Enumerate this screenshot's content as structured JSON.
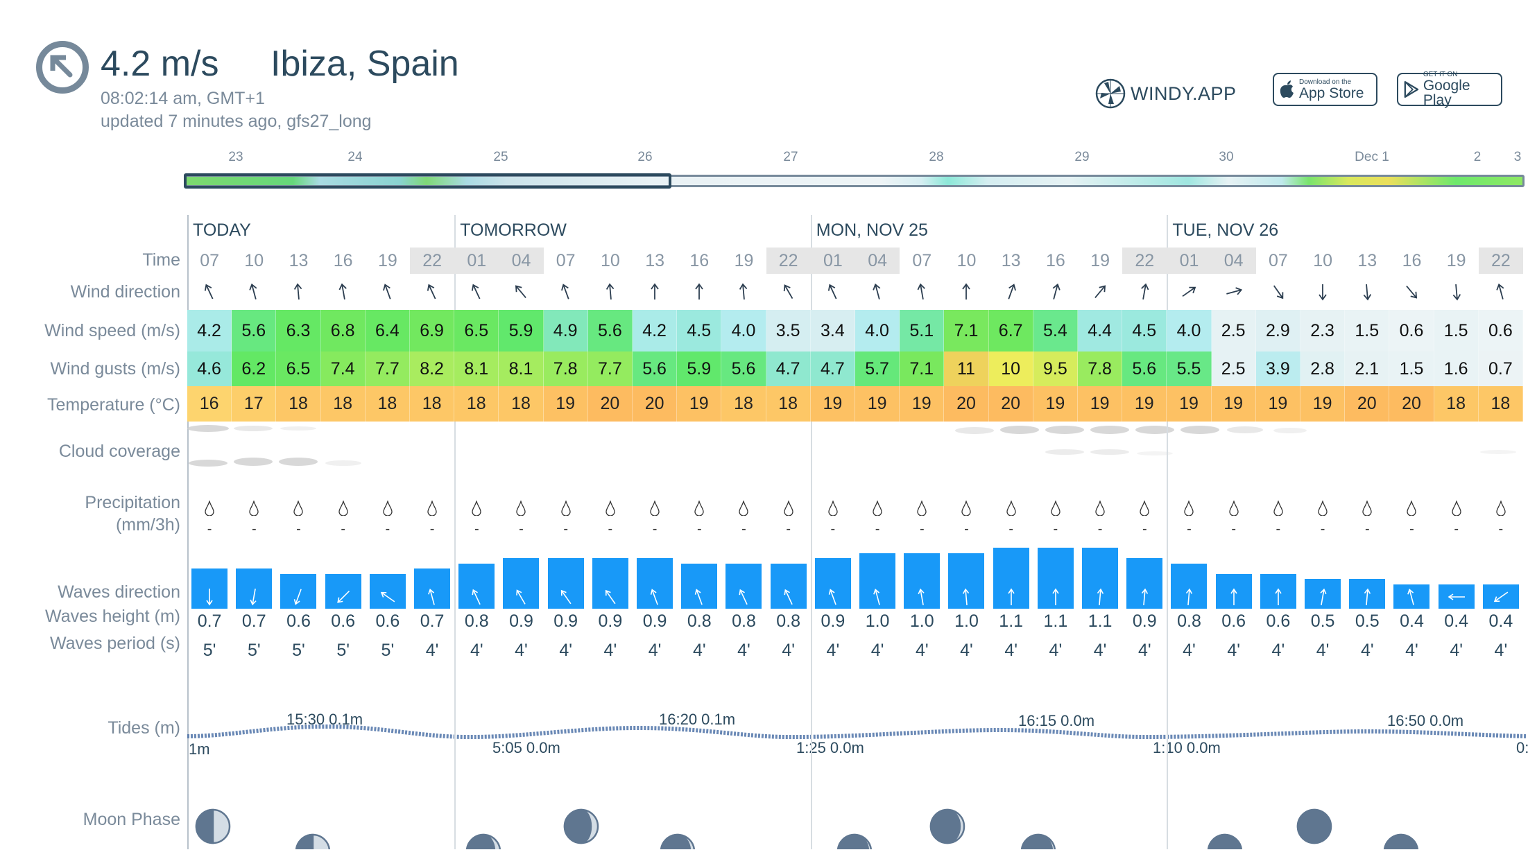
{
  "header": {
    "current_speed": "4.2 m/s",
    "location": "Ibiza, Spain",
    "local_time": "08:02:14 am, GMT+1",
    "updated": "updated 7 minutes ago, gfs27_long",
    "compass_icon": "arrow-up-left-in-circle"
  },
  "brand": {
    "logo_text": "WINDY.APP"
  },
  "stores": {
    "appstore_small": "Download on the",
    "appstore_big": "App Store",
    "gplay_small": "GET IT ON",
    "gplay_big": "Google Play"
  },
  "timeline": {
    "labels": [
      "23",
      "24",
      "25",
      "26",
      "27",
      "28",
      "29",
      "30",
      "Dec 1",
      "2",
      "3"
    ]
  },
  "row_labels": {
    "time": "Time",
    "wind_direction": "Wind direction",
    "wind_speed": "Wind speed (m/s)",
    "wind_gusts": "Wind gusts (m/s)",
    "temperature": "Temperature (°C)",
    "cloud": "Cloud coverage",
    "precip_1": "Precipitation",
    "precip_2": "(mm/3h)",
    "waves_direction": "Waves direction",
    "waves_height": "Waves height (m)",
    "waves_period": "Waves period (s)",
    "tides": "Tides (m)",
    "moon": "Moon Phase"
  },
  "days": [
    {
      "label": "TODAY",
      "start": 0
    },
    {
      "label": "TOMORROW",
      "start": 6
    },
    {
      "label": "MON, NOV 25",
      "start": 14
    },
    {
      "label": "TUE, NOV 26",
      "start": 22
    }
  ],
  "forecast": {
    "time": [
      "07",
      "10",
      "13",
      "16",
      "19",
      "22",
      "01",
      "04",
      "07",
      "10",
      "13",
      "16",
      "19",
      "22",
      "01",
      "04",
      "07",
      "10",
      "13",
      "16",
      "19",
      "22",
      "01",
      "04",
      "07",
      "10",
      "13",
      "16",
      "19",
      "22"
    ],
    "night": [
      false,
      false,
      false,
      false,
      false,
      true,
      true,
      true,
      false,
      false,
      false,
      false,
      false,
      true,
      true,
      true,
      false,
      false,
      false,
      false,
      false,
      true,
      true,
      true,
      false,
      false,
      false,
      false,
      false,
      true
    ],
    "wind_direction_deg": [
      -25,
      -15,
      -5,
      -10,
      -20,
      -25,
      -25,
      -40,
      -20,
      -5,
      0,
      0,
      -5,
      -30,
      -25,
      -15,
      -10,
      0,
      20,
      15,
      40,
      10,
      55,
      75,
      145,
      180,
      175,
      140,
      175,
      -15
    ],
    "wind_speed": [
      "4.2",
      "5.6",
      "6.3",
      "6.8",
      "6.4",
      "6.9",
      "6.5",
      "5.9",
      "4.9",
      "5.6",
      "4.2",
      "4.5",
      "4.0",
      "3.5",
      "3.4",
      "4.0",
      "5.1",
      "7.1",
      "6.7",
      "5.4",
      "4.4",
      "4.5",
      "4.0",
      "2.5",
      "2.9",
      "2.3",
      "1.5",
      "0.6",
      "1.5",
      "0.6"
    ],
    "wind_gusts": [
      "4.6",
      "6.2",
      "6.5",
      "7.4",
      "7.7",
      "8.2",
      "8.1",
      "8.1",
      "7.8",
      "7.7",
      "5.6",
      "5.9",
      "5.6",
      "4.7",
      "4.7",
      "5.7",
      "7.1",
      "11",
      "10",
      "9.5",
      "7.8",
      "5.6",
      "5.5",
      "2.5",
      "3.9",
      "2.8",
      "2.1",
      "1.5",
      "1.6",
      "0.7"
    ],
    "temperature": [
      "16",
      "17",
      "18",
      "18",
      "18",
      "18",
      "18",
      "18",
      "19",
      "20",
      "20",
      "19",
      "18",
      "18",
      "19",
      "19",
      "19",
      "20",
      "20",
      "19",
      "19",
      "19",
      "19",
      "19",
      "19",
      "19",
      "20",
      "20",
      "18",
      "18"
    ],
    "precipitation": [
      "-",
      "-",
      "-",
      "-",
      "-",
      "-",
      "-",
      "-",
      "-",
      "-",
      "-",
      "-",
      "-",
      "-",
      "-",
      "-",
      "-",
      "-",
      "-",
      "-",
      "-",
      "-",
      "-",
      "-",
      "-",
      "-",
      "-",
      "-",
      "-",
      "-"
    ],
    "waves_direction_deg": [
      180,
      190,
      200,
      225,
      -55,
      -15,
      -25,
      -30,
      -35,
      -35,
      -20,
      -20,
      -25,
      -25,
      -20,
      -15,
      -10,
      -5,
      0,
      0,
      5,
      5,
      5,
      0,
      0,
      10,
      5,
      -15,
      -90,
      -125
    ],
    "waves_height": [
      "0.7",
      "0.7",
      "0.6",
      "0.6",
      "0.6",
      "0.7",
      "0.8",
      "0.9",
      "0.9",
      "0.9",
      "0.9",
      "0.8",
      "0.8",
      "0.8",
      "0.9",
      "1.0",
      "1.0",
      "1.0",
      "1.1",
      "1.1",
      "1.1",
      "0.9",
      "0.8",
      "0.6",
      "0.6",
      "0.5",
      "0.5",
      "0.4",
      "0.4",
      "0.4"
    ],
    "waves_period": [
      "5'",
      "5'",
      "5'",
      "5'",
      "5'",
      "4'",
      "4'",
      "4'",
      "4'",
      "4'",
      "4'",
      "4'",
      "4'",
      "4'",
      "4'",
      "4'",
      "4'",
      "4'",
      "4'",
      "4'",
      "4'",
      "4'",
      "4'",
      "4'",
      "4'",
      "4'",
      "4'",
      "4'",
      "4'",
      "4'"
    ]
  },
  "tides": {
    "high": [
      "15:30 0.1m",
      "16:20 0.1m",
      "16:15 0.0m",
      "16:50 0.0m"
    ],
    "low": [
      "1m",
      "5:05 0.0m",
      "1:25 0.0m",
      "1:10 0.0m",
      "0:"
    ]
  },
  "colors": {
    "accent": "#2c4a5e",
    "label": "#7a8a9a",
    "wave_bar": "#1899f8",
    "wind_scale": [
      [
        0,
        "#eef4f6"
      ],
      [
        2.5,
        "#e6f2f4"
      ],
      [
        3.5,
        "#d5eef1"
      ],
      [
        4.0,
        "#b4ecef"
      ],
      [
        4.6,
        "#96e8da"
      ],
      [
        5.2,
        "#6ee89a"
      ],
      [
        6.0,
        "#5fe866"
      ],
      [
        7.0,
        "#74e85e"
      ],
      [
        8.0,
        "#a2ec5f"
      ],
      [
        9.5,
        "#d6ec5c"
      ],
      [
        10,
        "#eded5c"
      ],
      [
        11,
        "#eed25c"
      ]
    ],
    "temp_scale": [
      [
        16,
        "#fdd46e"
      ],
      [
        18,
        "#fdc766"
      ],
      [
        20,
        "#fdbb60"
      ]
    ]
  }
}
